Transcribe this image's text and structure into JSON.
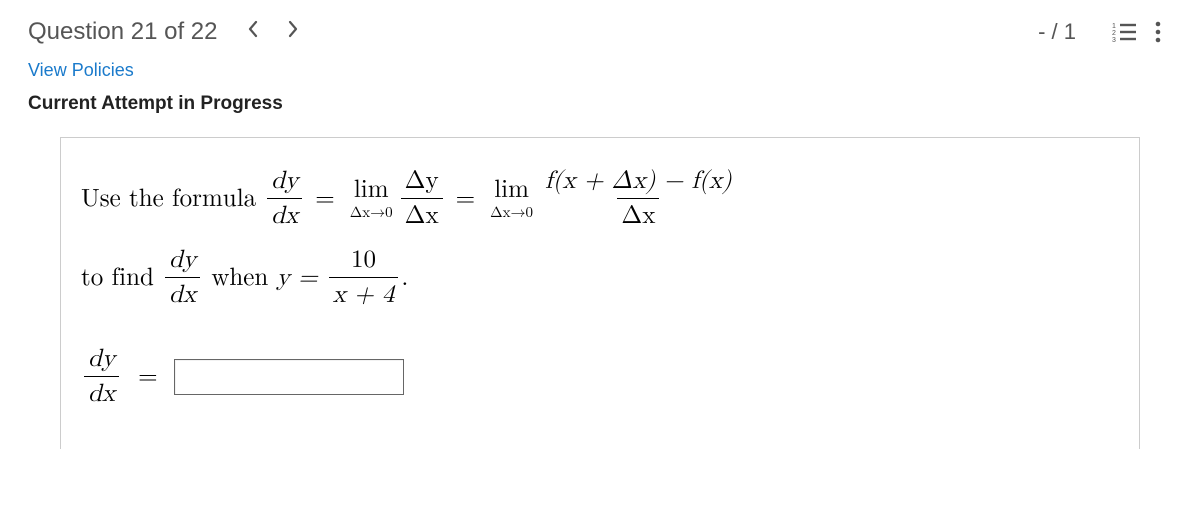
{
  "header": {
    "title": "Question 21 of 22",
    "score": "- / 1"
  },
  "links": {
    "view_policies": "View Policies"
  },
  "status": {
    "attempt": "Current Attempt in Progress"
  },
  "question": {
    "intro": "Use the formula",
    "dy": "dy",
    "dx": "dx",
    "eq": "=",
    "lim": "lim",
    "dx0": "Δx→0",
    "Dy": "Δy",
    "Dx": "Δx",
    "fnum": "f(x + Δx) − f(x)",
    "to_find": "to find",
    "when": " when ",
    "yeq": "y =",
    "ten": "10",
    "xplus4": "x + 4",
    "dot": "."
  },
  "answer": {
    "value": ""
  }
}
